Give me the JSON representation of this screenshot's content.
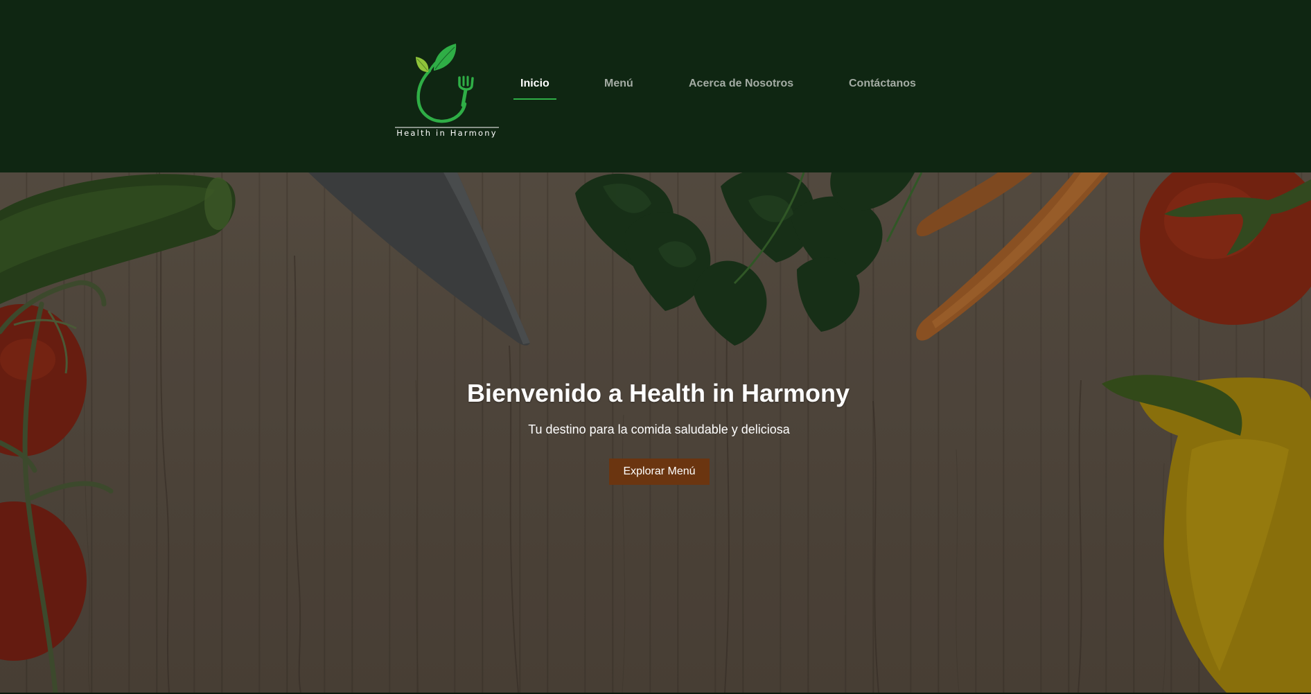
{
  "brand": {
    "name": "Health in Harmony",
    "logo_icon": "leaf-fork-icon",
    "logo_color": "#2fae46"
  },
  "nav": {
    "items": [
      {
        "label": "Inicio",
        "active": true
      },
      {
        "label": "Menú",
        "active": false
      },
      {
        "label": "Acerca de Nosotros",
        "active": false
      },
      {
        "label": "Contáctanos",
        "active": false
      }
    ]
  },
  "hero": {
    "title": "Bienvenido a Health in Harmony",
    "subtitle": "Tu destino para la comida saludable y deliciosa",
    "button_label": "Explorar Menú",
    "button_color": "#6b3510"
  },
  "colors": {
    "header_bg": "#0f2612",
    "accent": "#2fae46",
    "nav_text": "#a4aca4",
    "nav_active_text": "#ffffff"
  }
}
